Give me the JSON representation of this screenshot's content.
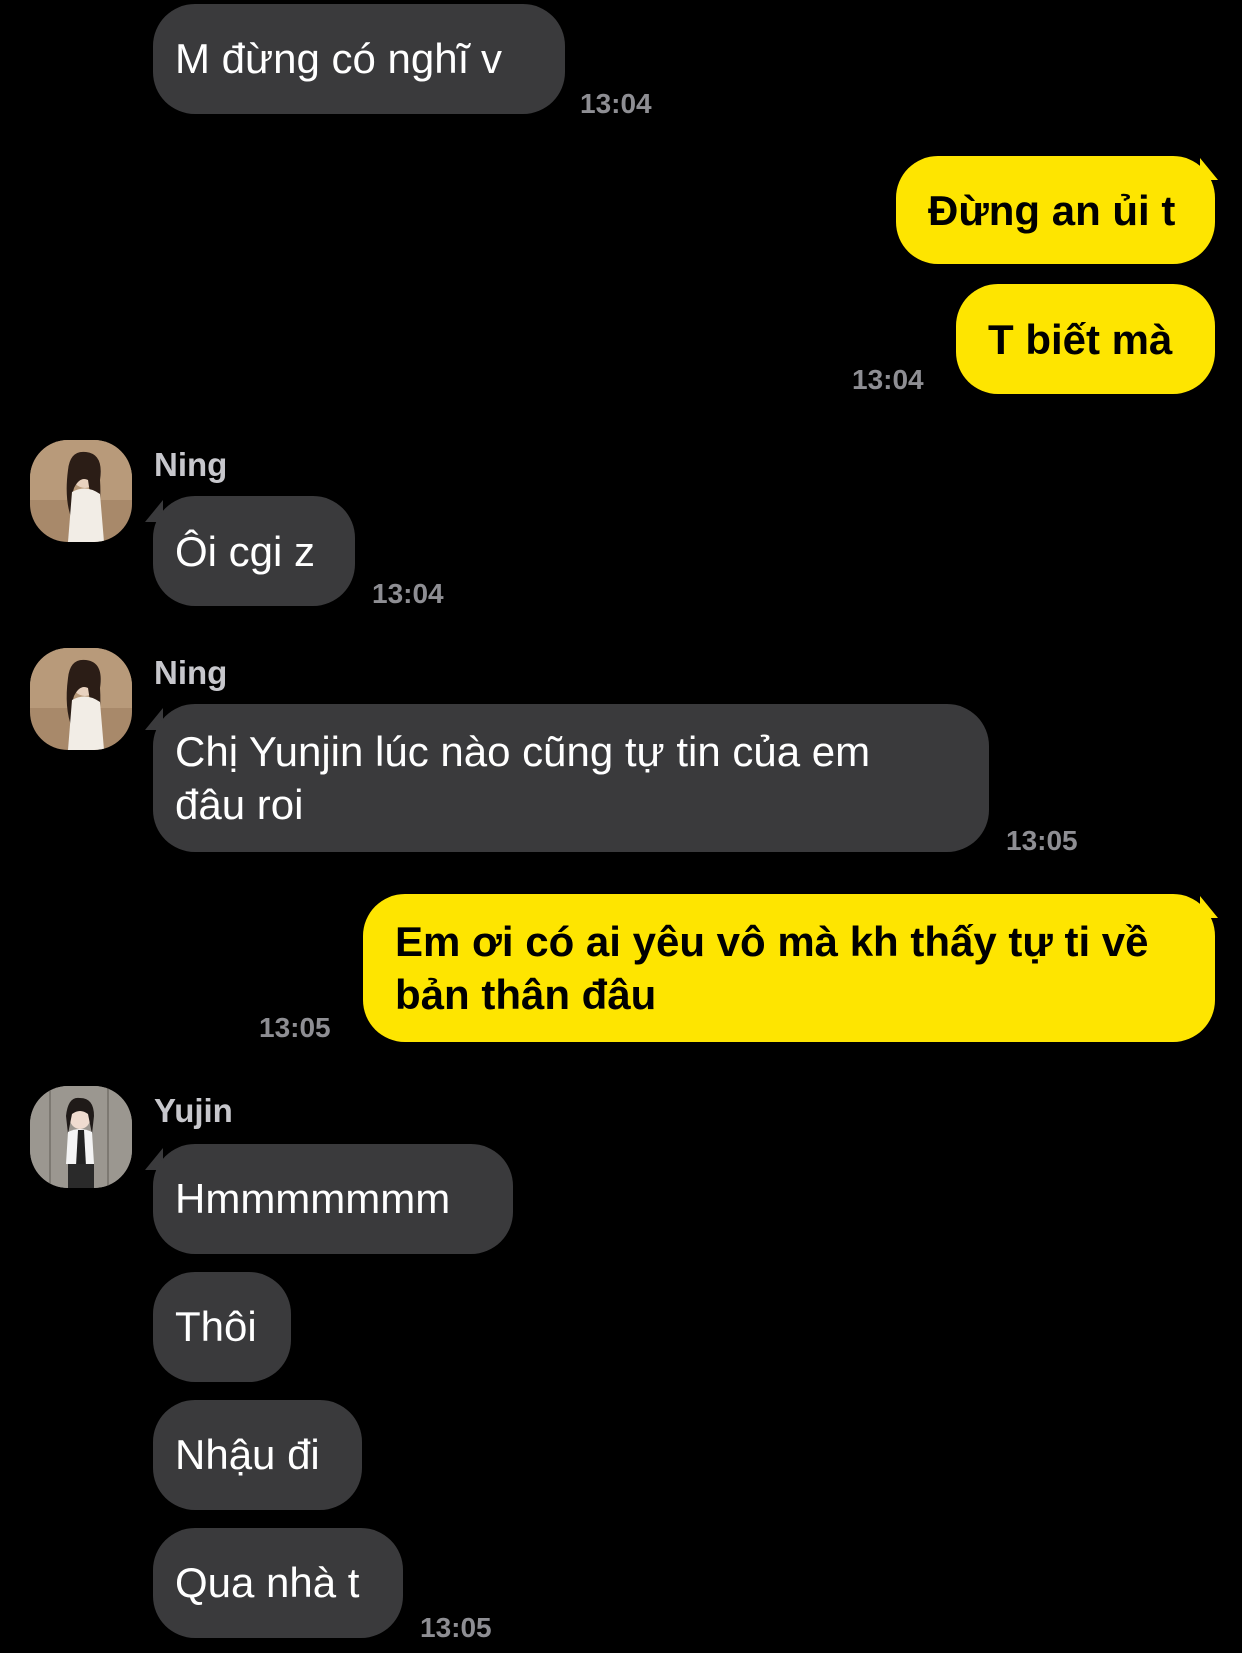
{
  "messages": {
    "m1": {
      "text": "M đừng có nghĩ v",
      "time": "13:04"
    },
    "m2": {
      "text": "Đừng an ủi t"
    },
    "m3": {
      "text": "T biết mà",
      "time": "13:04"
    },
    "m4": {
      "sender": "Ning",
      "text": "Ôi cgi z",
      "time": "13:04"
    },
    "m5": {
      "sender": "Ning",
      "line1": "Chị Yunjin lúc nào cũng tự tin của em",
      "line2": "đâu roi",
      "time": "13:05"
    },
    "m6": {
      "line1": "Em ơi có ai yêu vô mà kh thấy tự ti về",
      "line2": "bản thân đâu",
      "time": "13:05"
    },
    "m7": {
      "sender": "Yujin",
      "text": "Hmmmmmmm"
    },
    "m8": {
      "text": "Thôi"
    },
    "m9": {
      "text": "Nhậu đi"
    },
    "m10": {
      "text": "Qua nhà t",
      "time": "13:05"
    }
  },
  "avatars": {
    "ning": "avatar-ning",
    "yujin": "avatar-yujin"
  },
  "colors": {
    "background": "#000000",
    "incoming_bubble": "#3a3a3c",
    "outgoing_bubble": "#fee500",
    "timestamp": "#8e8e93"
  }
}
